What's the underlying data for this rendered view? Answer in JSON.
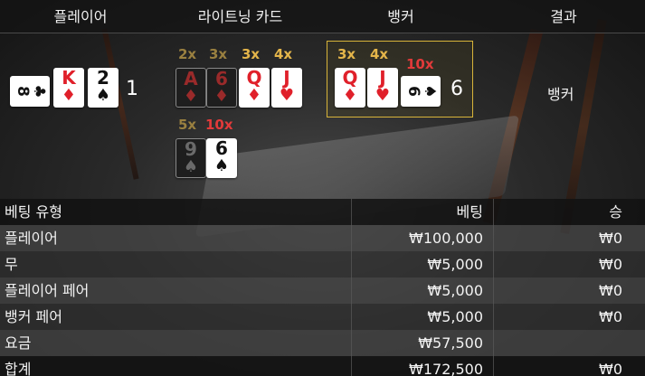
{
  "header": {
    "player": "플레이어",
    "lightning_cards": "라이트닝 카드",
    "banker": "뱅커",
    "result": "결과"
  },
  "player": {
    "cards": [
      {
        "rank": "8",
        "suit": "♣",
        "color": "black",
        "orientation": "sideways"
      },
      {
        "rank": "K",
        "suit": "♦",
        "color": "red"
      },
      {
        "rank": "2",
        "suit": "♠",
        "color": "black"
      }
    ],
    "score": "1"
  },
  "lightning": {
    "cards": [
      {
        "mult": "2x",
        "rank": "A",
        "suit": "♦",
        "color": "red",
        "active": false
      },
      {
        "mult": "3x",
        "rank": "6",
        "suit": "♦",
        "color": "red",
        "active": false
      },
      {
        "mult": "3x",
        "rank": "Q",
        "suit": "♦",
        "color": "red",
        "active": true
      },
      {
        "mult": "4x",
        "rank": "J",
        "suit": "♥",
        "color": "red",
        "active": true
      },
      {
        "mult": "5x",
        "rank": "9",
        "suit": "♠",
        "color": "black",
        "active": false
      },
      {
        "mult": "10x",
        "rank": "6",
        "suit": "♠",
        "color": "black",
        "active": true
      }
    ]
  },
  "banker": {
    "cards": [
      {
        "mult": "3x",
        "rank": "Q",
        "suit": "♦",
        "color": "red"
      },
      {
        "mult": "4x",
        "rank": "J",
        "suit": "♥",
        "color": "red"
      },
      {
        "mult": "10x",
        "rank": "6",
        "suit": "♠",
        "color": "black",
        "orientation": "sideways"
      }
    ],
    "score": "6"
  },
  "result": "뱅커",
  "bets_table": {
    "headers": [
      "베팅 유형",
      "베팅",
      "승"
    ],
    "rows": [
      {
        "type": "플레이어",
        "bet": "₩100,000",
        "win": "₩0"
      },
      {
        "type": "무",
        "bet": "₩5,000",
        "win": "₩0"
      },
      {
        "type": "플레이어 페어",
        "bet": "₩5,000",
        "win": "₩0"
      },
      {
        "type": "뱅커 페어",
        "bet": "₩5,000",
        "win": "₩0"
      },
      {
        "type": "요금",
        "bet": "₩57,500",
        "win": ""
      }
    ],
    "total": {
      "type": "합계",
      "bet": "₩172,500",
      "win": "₩0"
    }
  },
  "colors": {
    "gold_multiplier": "#e4b54a",
    "red_multiplier": "#e23a3a",
    "card_red": "#e0202a",
    "highlight_border": "#d8b43a"
  }
}
